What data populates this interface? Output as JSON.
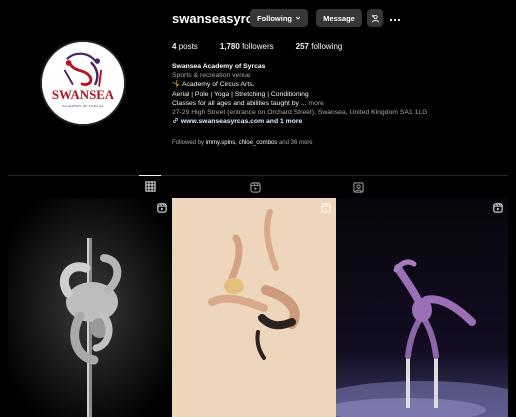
{
  "profile": {
    "username": "swanseasyrcas",
    "avatar": {
      "logo_text": "SWANSEA",
      "logo_subtext": "ACADEMY OF SYRCAS"
    },
    "buttons": {
      "following_label": "Following",
      "message_label": "Message",
      "suggest_icon": "add-person-icon",
      "more_icon": "more-options-icon"
    },
    "stats": {
      "posts_count": "4",
      "posts_label": "posts",
      "followers_count": "1,780",
      "followers_label": "followers",
      "following_count": "257",
      "following_label": "following"
    },
    "bio": {
      "name": "Swansea Academy of Syrcas",
      "category": "Sports & recreation venue",
      "line1": "🤸 Academy of Circus Arts.",
      "line2": "Aerial | Pole | Yoga | Stretching | Conditioning",
      "line3": "Classes for all ages and abilities taught by ...",
      "more": "more",
      "address": "27-29 High Street (entrance on Orchard Street), Swansea, United Kingdom SA1 1LG",
      "link_text": "www.swanseasyrcas.com and 1 more"
    },
    "followed_by": {
      "prefix": "Followed by",
      "names": "immy.spins, chloe_combos",
      "suffix": "and 36 more"
    }
  },
  "tabs": [
    {
      "icon": "grid-icon",
      "active": true
    },
    {
      "icon": "reels-icon",
      "active": false
    },
    {
      "icon": "tagged-icon",
      "active": false
    }
  ],
  "posts": [
    {
      "subject": "pole dancer inverted on pole, black and white",
      "type": "reel"
    },
    {
      "subject": "aerial hoop performer on cream background",
      "type": "reel"
    },
    {
      "subject": "hand balancer on canes in purple costume",
      "type": "reel"
    }
  ],
  "colors": {
    "background": "#000000",
    "button_bg": "#363636",
    "muted_text": "#a8a8a8",
    "link_text": "#e0f1ff",
    "logo_red": "#b3121f",
    "logo_purple": "#4a2466"
  }
}
